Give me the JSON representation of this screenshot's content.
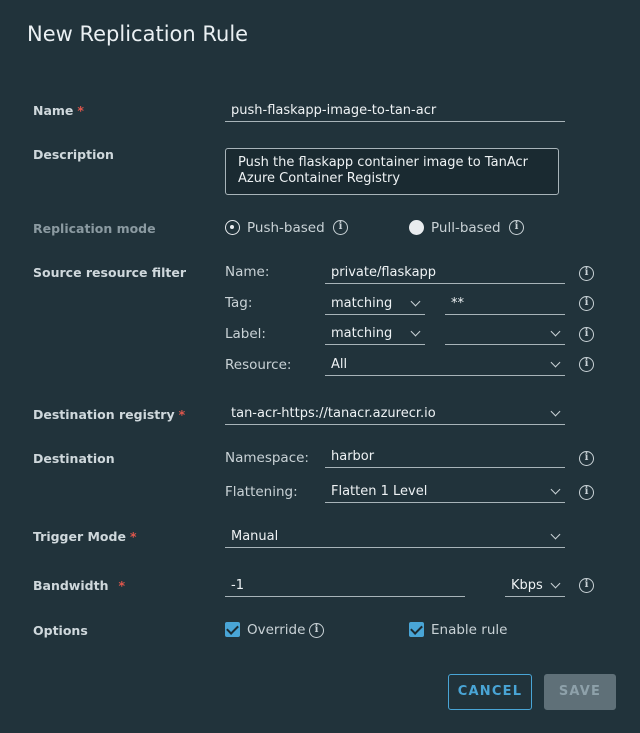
{
  "dialog": {
    "title": "New Replication Rule"
  },
  "name": {
    "label": "Name",
    "required_mark": "*",
    "value": "push-flaskapp-image-to-tan-acr"
  },
  "description": {
    "label": "Description",
    "value_line1": "Push the flaskapp container image to TanAcr",
    "value_line2": "Azure Container Registry"
  },
  "replication_mode": {
    "label": "Replication mode",
    "push_label": "Push-based",
    "pull_label": "Pull-based",
    "selected": "push"
  },
  "source_filter": {
    "label": "Source resource filter",
    "name_label": "Name:",
    "name_value": "private/flaskapp",
    "tag_label": "Tag:",
    "tag_mode": "matching",
    "tag_value": "**",
    "label_label": "Label:",
    "label_mode": "matching",
    "label_value": "",
    "resource_label": "Resource:",
    "resource_value": "All"
  },
  "destination_registry": {
    "label": "Destination registry",
    "required_mark": "*",
    "value": "tan-acr-https://tanacr.azurecr.io"
  },
  "destination": {
    "label": "Destination",
    "namespace_label": "Namespace:",
    "namespace_value": "harbor",
    "flattening_label": "Flattening:",
    "flattening_value": "Flatten 1 Level"
  },
  "trigger_mode": {
    "label": "Trigger Mode",
    "required_mark": "*",
    "value": "Manual"
  },
  "bandwidth": {
    "label": "Bandwidth",
    "required_mark": "*",
    "value": "-1",
    "unit": "Kbps"
  },
  "options": {
    "label": "Options",
    "override_label": "Override",
    "override_checked": true,
    "enable_label": "Enable rule",
    "enable_checked": true
  },
  "buttons": {
    "cancel": "CANCEL",
    "save": "SAVE"
  },
  "icons": {
    "info": "info-icon",
    "chevron": "chevron-down-icon",
    "checkbox": "checkbox-checked-icon"
  },
  "colors": {
    "background": "#21333b",
    "accent": "#49a5d6",
    "required": "#e0574c",
    "disabled_button": "#5f7078"
  }
}
